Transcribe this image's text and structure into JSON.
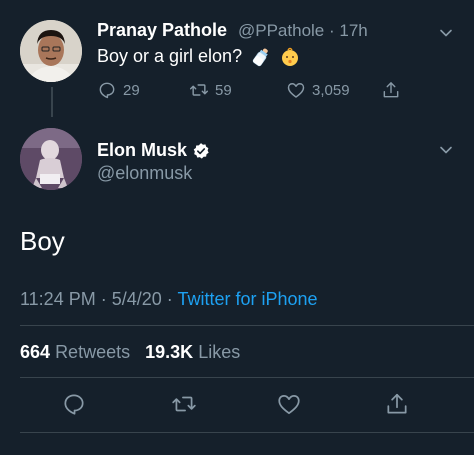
{
  "reply_to": {
    "name": "Pranay Pathole",
    "handle": "@PPathole",
    "time": "17h",
    "text": "Boy or a girl elon?",
    "emojis": [
      "baby-bottle-emoji",
      "baby-face-emoji"
    ],
    "reply_count": "29",
    "retweet_count": "59",
    "like_count": "3,059"
  },
  "tweet": {
    "name": "Elon Musk",
    "handle": "@elonmusk",
    "verified": true,
    "text": "Boy",
    "time": "11:24 PM",
    "date": "5/4/20",
    "source": "Twitter for iPhone",
    "retweets_count": "664",
    "retweets_label": "Retweets",
    "likes_count": "19.3K",
    "likes_label": "Likes"
  },
  "colors": {
    "background": "#15202b",
    "muted": "#8899a6",
    "accent": "#1da1f2",
    "divider": "#38444d"
  },
  "icons": [
    "chevron-down-icon",
    "reply-icon",
    "retweet-icon",
    "like-icon",
    "share-icon",
    "verified-badge-icon"
  ]
}
